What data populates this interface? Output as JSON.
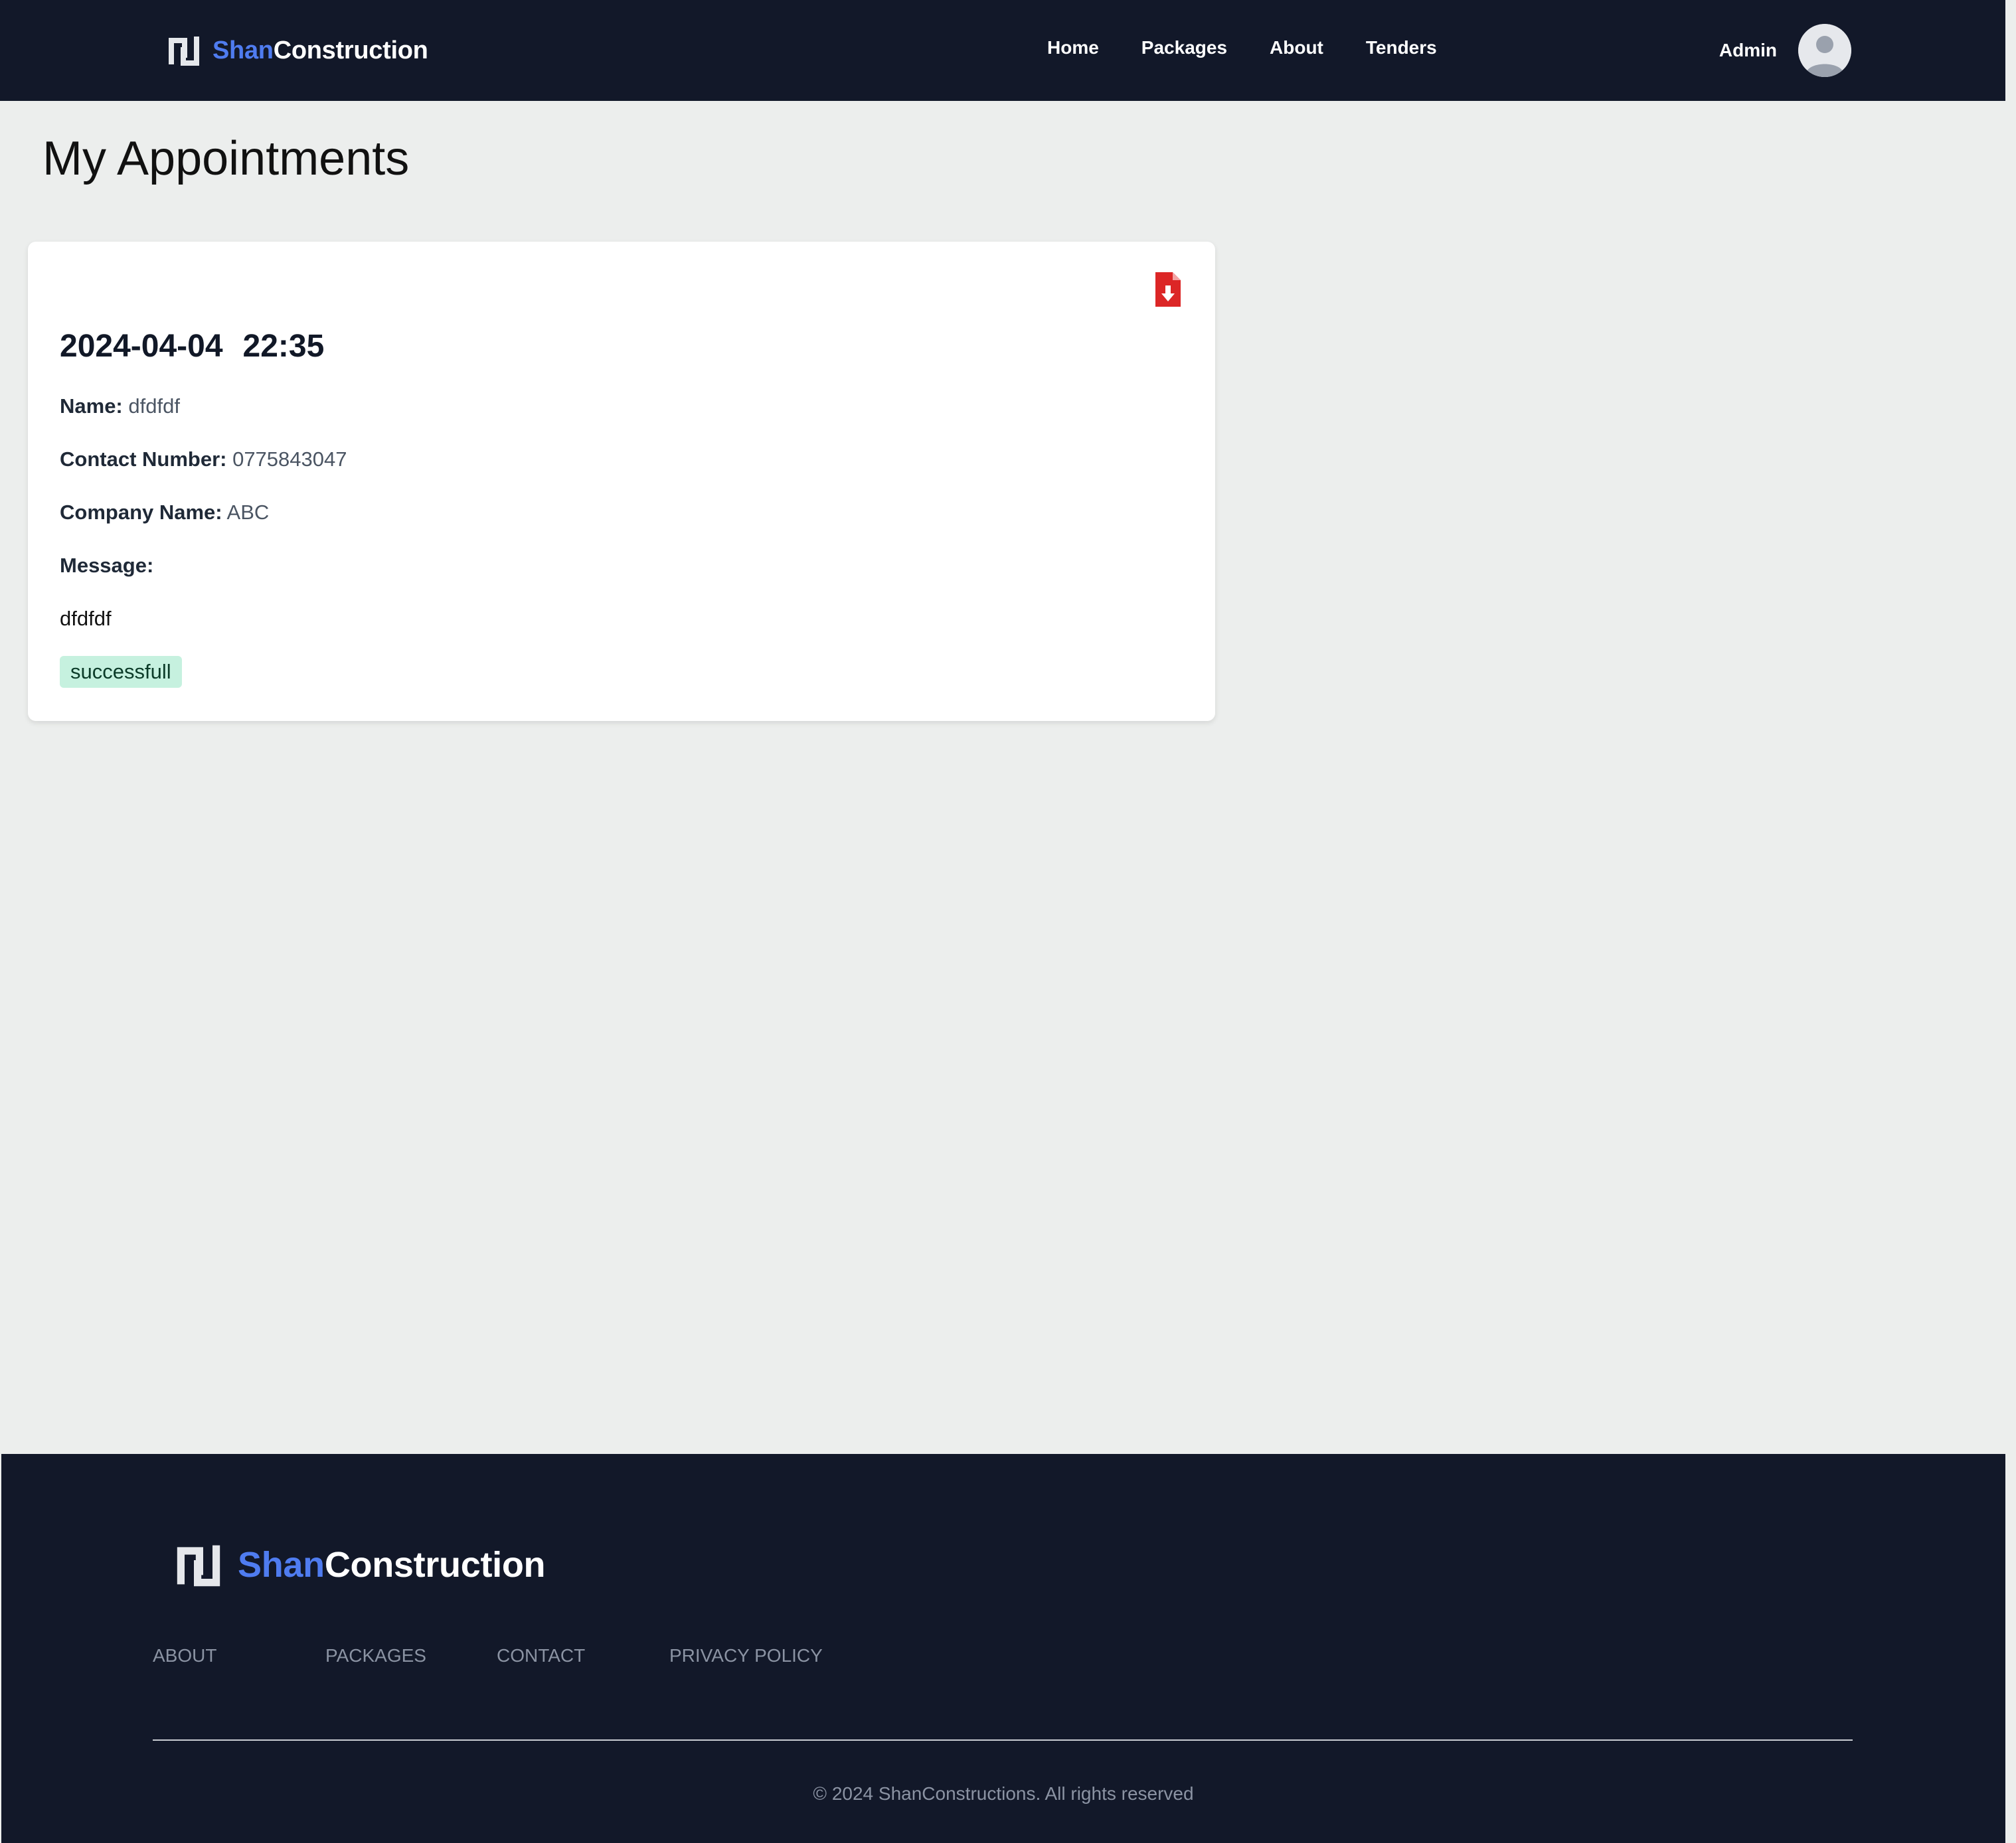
{
  "header": {
    "brand": {
      "accent": "Shan",
      "rest": "Construction"
    },
    "nav": [
      "Home",
      "Packages",
      "About",
      "Tenders"
    ],
    "user_name": "Admin"
  },
  "main": {
    "title": "My Appointments",
    "appointment": {
      "date": "2024-04-04",
      "time": "22:35",
      "name_label": "Name:",
      "name_value": "dfdfdf",
      "contact_label": "Contact Number:",
      "contact_value": "0775843047",
      "company_label": "Company Name:",
      "company_value": "ABC",
      "message_label": "Message:",
      "message_value": "dfdfdf",
      "status": "successfull"
    },
    "pdf_icon": "file-download-icon"
  },
  "footer": {
    "brand": {
      "accent": "Shan",
      "rest": "Construction"
    },
    "links": [
      "ABOUT",
      "PACKAGES",
      "CONTACT",
      "PRIVACY POLICY"
    ],
    "copyright": "© 2024 ShanConstructions. All rights reserved"
  },
  "colors": {
    "header_bg": "#121829",
    "accent_blue": "#4f7cf0",
    "page_bg": "#eceeed",
    "status_bg": "#c6f1df",
    "pdf_red": "#dc2626"
  }
}
